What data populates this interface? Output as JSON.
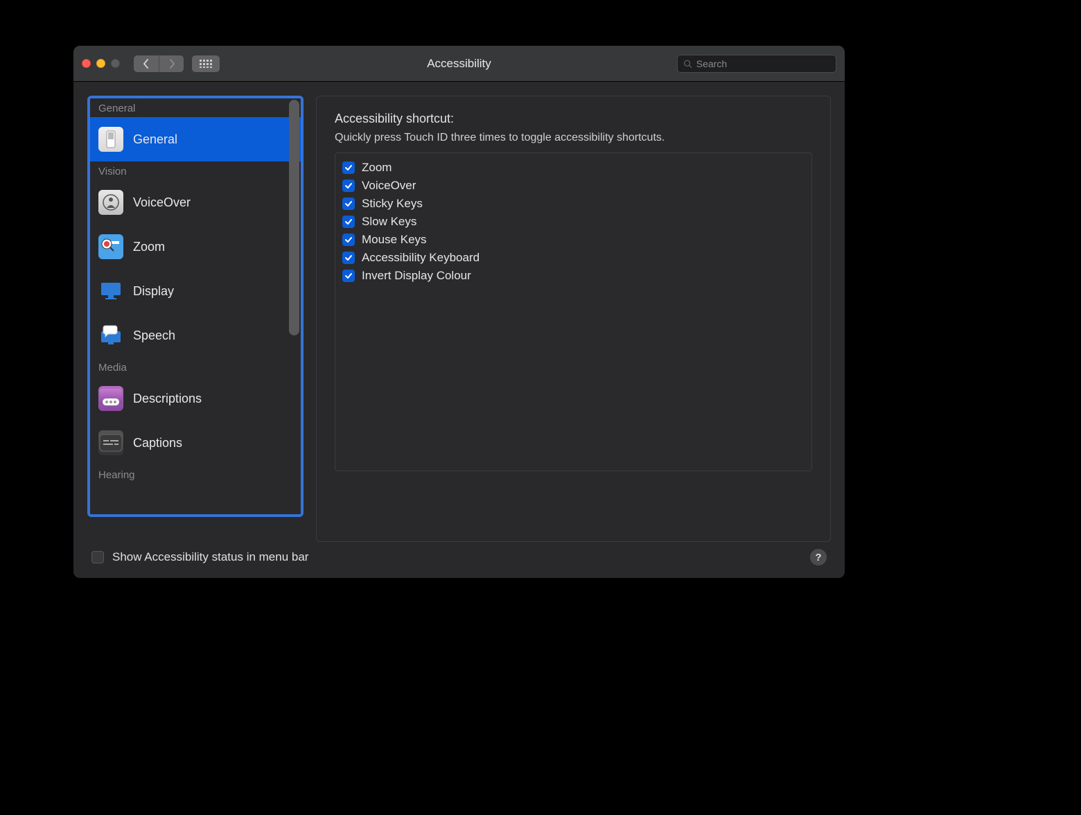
{
  "window": {
    "title": "Accessibility",
    "search_placeholder": "Search"
  },
  "sidebar": {
    "sections": [
      {
        "label": "General",
        "items": [
          {
            "label": "General",
            "icon": "general",
            "selected": true
          }
        ]
      },
      {
        "label": "Vision",
        "items": [
          {
            "label": "VoiceOver",
            "icon": "voiceover"
          },
          {
            "label": "Zoom",
            "icon": "zoom"
          },
          {
            "label": "Display",
            "icon": "display"
          },
          {
            "label": "Speech",
            "icon": "speech"
          }
        ]
      },
      {
        "label": "Media",
        "items": [
          {
            "label": "Descriptions",
            "icon": "desc"
          },
          {
            "label": "Captions",
            "icon": "captions"
          }
        ]
      },
      {
        "label": "Hearing",
        "items": []
      }
    ]
  },
  "main": {
    "heading": "Accessibility shortcut:",
    "subtext": "Quickly press Touch ID three times to toggle accessibility shortcuts.",
    "shortcuts": [
      {
        "label": "Zoom",
        "checked": true
      },
      {
        "label": "VoiceOver",
        "checked": true
      },
      {
        "label": "Sticky Keys",
        "checked": true
      },
      {
        "label": "Slow Keys",
        "checked": true
      },
      {
        "label": "Mouse Keys",
        "checked": true
      },
      {
        "label": "Accessibility Keyboard",
        "checked": true
      },
      {
        "label": "Invert Display Colour",
        "checked": true
      }
    ]
  },
  "footer": {
    "show_status_label": "Show Accessibility status in menu bar",
    "show_status_checked": false
  }
}
